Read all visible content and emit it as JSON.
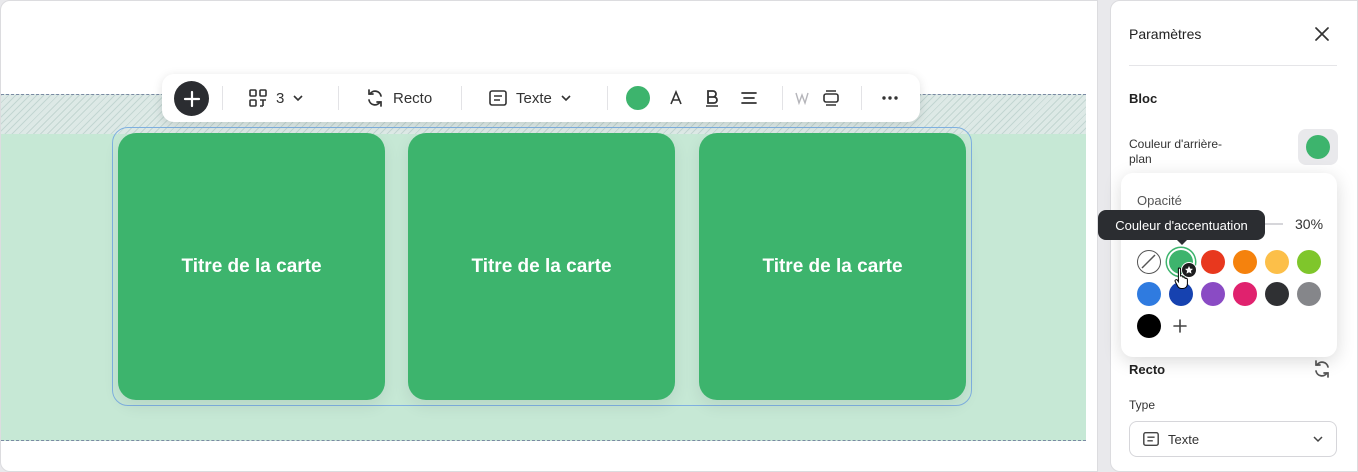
{
  "toolbar": {
    "columns_count": "3",
    "face_label": "Recto",
    "content_type_label": "Texte",
    "current_color": "#3db46d"
  },
  "cards": [
    {
      "title": "Titre de la carte"
    },
    {
      "title": "Titre de la carte"
    },
    {
      "title": "Titre de la carte"
    }
  ],
  "panel": {
    "title": "Paramètres",
    "section_block": "Bloc",
    "background_color_label_line1": "Couleur d'arrière-",
    "background_color_label_line2": "plan",
    "section_face": "Recto",
    "type_label": "Type",
    "type_value": "Texte"
  },
  "color_popover": {
    "opacity_label": "Opacité",
    "opacity_value": "30%",
    "tooltip": "Couleur d'accentuation",
    "swatches": [
      "none",
      "#3db46d",
      "#e8381e",
      "#f5820d",
      "#fcbf49",
      "#7fc62b",
      "#2f7be0",
      "#1642b0",
      "#8a4bc4",
      "#e0226e",
      "#2f3033",
      "#85868a",
      "#000000"
    ]
  }
}
